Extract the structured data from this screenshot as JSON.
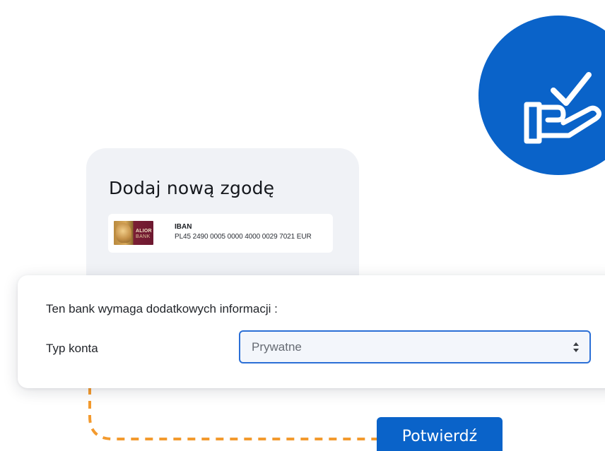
{
  "consent_card": {
    "title": "Dodaj nową zgodę",
    "account": {
      "bank_logo_text_line1": "ALIOR",
      "bank_logo_text_line2": "BANK",
      "iban_label": "IBAN",
      "iban_value": "PL45 2490 0005 0000 4000 0029 7021 EUR"
    }
  },
  "extra_info_panel": {
    "heading": "Ten bank wymaga dodatkowych informacji :",
    "account_type_label": "Typ konta",
    "account_type_value": "Prywatne"
  },
  "confirm_button": {
    "label": "Potwierdź"
  },
  "badge": {
    "icon": "hand-checkmark-icon"
  },
  "colors": {
    "primary_blue": "#0a63c9",
    "connector_orange": "#f39a2e",
    "card_background": "#f0f2f6"
  }
}
